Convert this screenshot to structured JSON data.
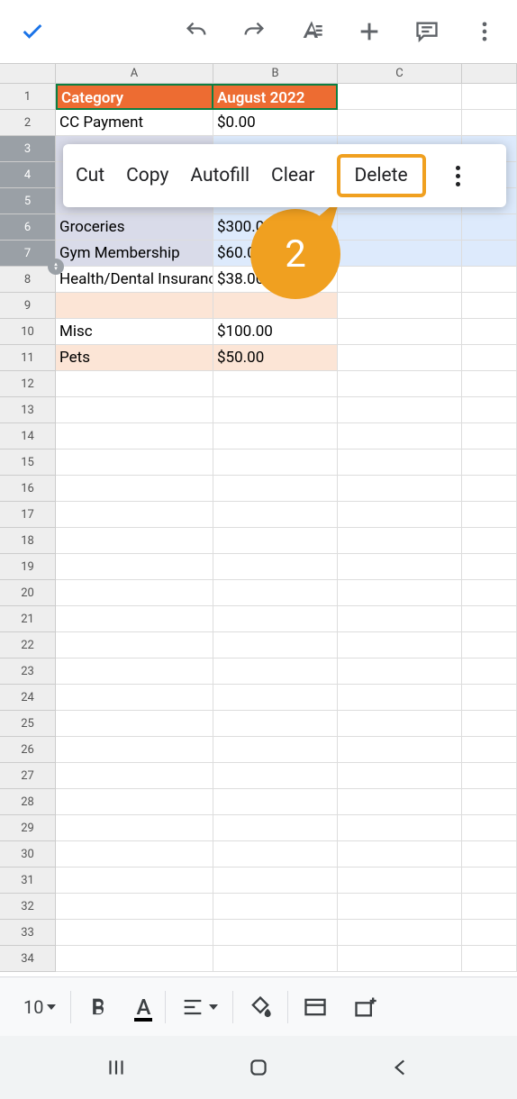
{
  "toolbar": {
    "font_size": "10"
  },
  "columns": [
    "A",
    "B",
    "C"
  ],
  "header_row": {
    "A": "Category",
    "B": "August 2022"
  },
  "rows": [
    {
      "n": 1,
      "A": "Category",
      "B": "August 2022",
      "header": true
    },
    {
      "n": 2,
      "A": "CC Payment",
      "B": "$0.00"
    },
    {
      "n": 3,
      "selected": true
    },
    {
      "n": 4,
      "selected": true
    },
    {
      "n": 5,
      "selected": true
    },
    {
      "n": 6,
      "A": "Groceries",
      "B": "$300.00",
      "selected": true
    },
    {
      "n": 7,
      "A": "Gym Membership",
      "B": "$60.00",
      "selected": true
    },
    {
      "n": 8,
      "A": "Health/Dental Insurance",
      "B": "$38.00"
    },
    {
      "n": 9,
      "peach": true
    },
    {
      "n": 10,
      "A": "Misc",
      "B": "$100.00"
    },
    {
      "n": 11,
      "A": "Pets",
      "B": "$50.00",
      "peach": true
    },
    {
      "n": 12
    },
    {
      "n": 13
    },
    {
      "n": 14
    },
    {
      "n": 15
    },
    {
      "n": 16
    },
    {
      "n": 17
    },
    {
      "n": 18
    },
    {
      "n": 19
    },
    {
      "n": 20
    },
    {
      "n": 21
    },
    {
      "n": 22
    },
    {
      "n": 23
    },
    {
      "n": 24
    },
    {
      "n": 25
    },
    {
      "n": 26
    },
    {
      "n": 27
    },
    {
      "n": 28
    },
    {
      "n": 29
    },
    {
      "n": 30
    },
    {
      "n": 31
    },
    {
      "n": 32
    },
    {
      "n": 33
    },
    {
      "n": 34
    }
  ],
  "context_menu": {
    "cut": "Cut",
    "copy": "Copy",
    "autofill": "Autofill",
    "clear": "Clear",
    "delete": "Delete"
  },
  "annotation": {
    "step": "2"
  }
}
